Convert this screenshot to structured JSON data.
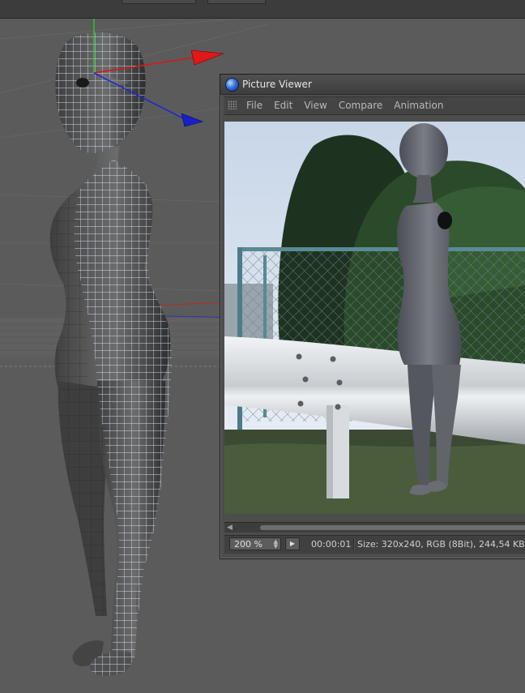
{
  "picture_viewer": {
    "title": "Picture Viewer",
    "menu": [
      "File",
      "Edit",
      "View",
      "Compare",
      "Animation"
    ],
    "status": {
      "zoom": "200 %",
      "time": "00:00:01",
      "info": "Size: 320x240, RGB (8Bit), 244,54 KB"
    }
  },
  "icons": {
    "logo": "picture-viewer-logo-icon",
    "grip": "menu-grip-icon",
    "play": "play-icon",
    "spin": "zoom-spinner-icon",
    "scroll_left": "scroll-left-icon"
  },
  "colors": {
    "viewport_bg": "#5b5b5b",
    "axis_x": "#d81818",
    "axis_y": "#28c828",
    "axis_z": "#1c2ad0",
    "wire": "#dce8ff"
  }
}
